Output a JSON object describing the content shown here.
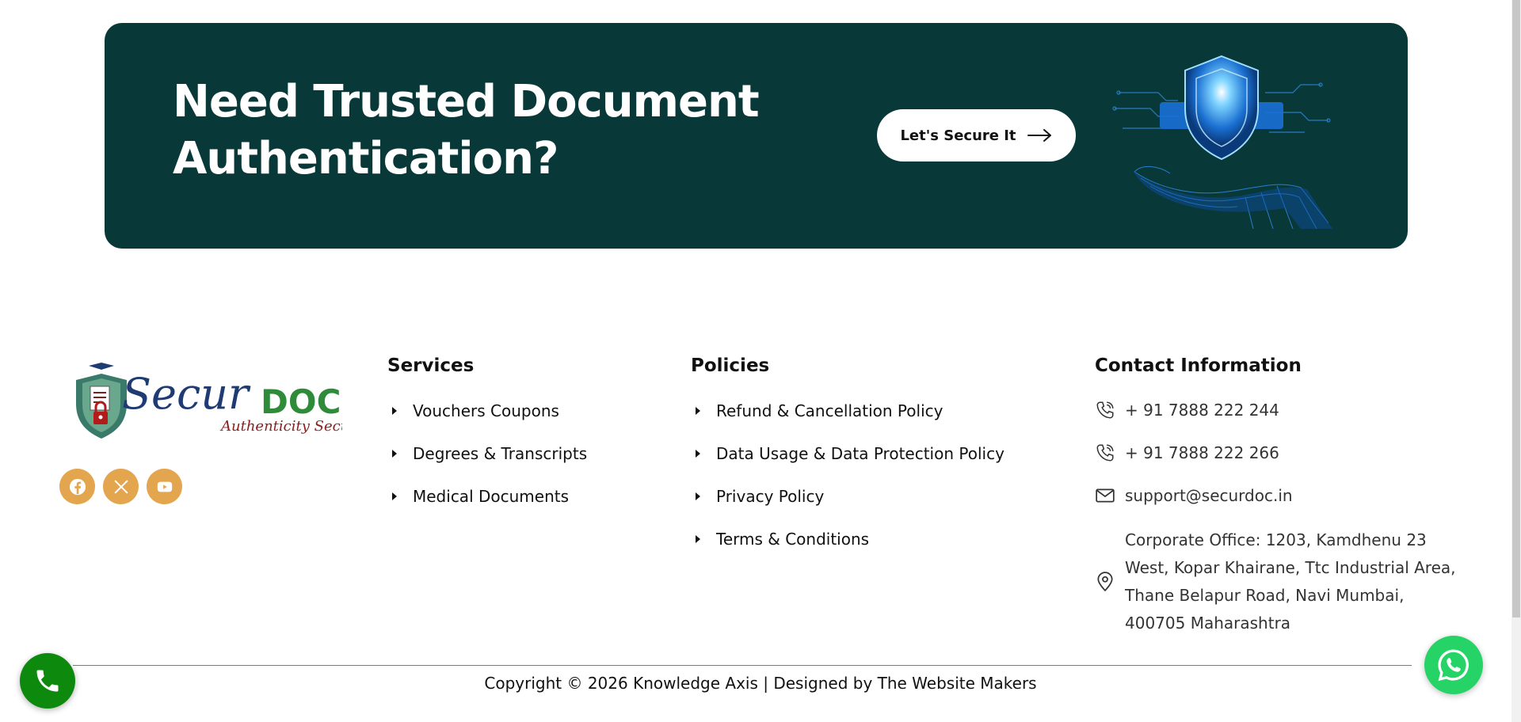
{
  "cta": {
    "title_line1": "Need Trusted Document",
    "title_line2": "Authentication?",
    "button_label": "Let's Secure It",
    "background": "#093838"
  },
  "brand": {
    "logo_main": "Secur",
    "logo_accent": "DOC",
    "tagline": "Authenticity Secured",
    "primary_color": "#1f3b73",
    "accent_color": "#2e8b3a"
  },
  "socials": [
    {
      "icon": "facebook-icon"
    },
    {
      "icon": "x-twitter-icon"
    },
    {
      "icon": "youtube-icon"
    }
  ],
  "services": {
    "heading": "Services",
    "items": [
      "Vouchers Coupons",
      "Degrees & Transcripts",
      "Medical Documents"
    ]
  },
  "policies": {
    "heading": "Policies",
    "items": [
      "Refund & Cancellation Policy",
      "Data Usage & Data Protection Policy",
      "Privacy Policy",
      "Terms & Conditions"
    ]
  },
  "contact": {
    "heading": "Contact Information",
    "phone1": "+ 91 7888 222 244",
    "phone2": "+ 91 7888 222 266",
    "email": "support@securdoc.in",
    "address": "Corporate Office: 1203, Kamdhenu 23 West, Kopar Khairane, Ttc Industrial Area, Thane Belapur Road, Navi Mumbai, 400705 Maharashtra"
  },
  "footer": {
    "copyright": "Copyright © 2026 Knowledge Axis | Designed by The Website Makers"
  },
  "floating": {
    "call_icon": "phone-icon",
    "whatsapp_icon": "whatsapp-icon"
  }
}
